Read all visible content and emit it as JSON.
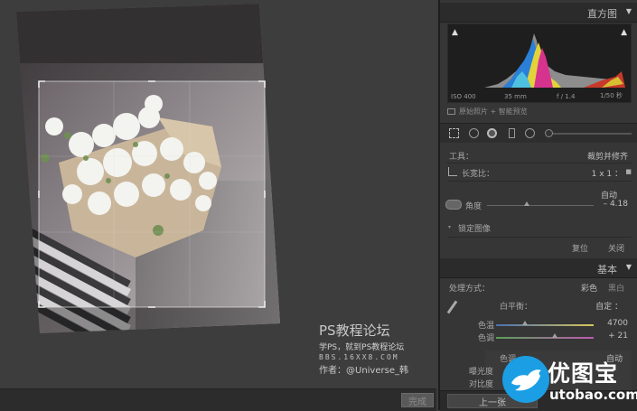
{
  "canvas": {
    "done_label": "完成",
    "watermark": {
      "title": "PS教程论坛",
      "subtitle": "学PS，就到PS教程论坛",
      "site": "BBS.16XX8.COM",
      "author": "作者：@Universe_韩"
    }
  },
  "histogram": {
    "title": "直方图",
    "iso": "ISO 400",
    "focal": "35 mm",
    "aperture": "f / 1.4",
    "shutter": "1/50 秒",
    "preview_label": "原始照片 + 智能预览"
  },
  "crop": {
    "tool_label": "工具：",
    "tool_name": "裁剪并修齐",
    "aspect_label": "长宽比：",
    "aspect_value": "1 x 1 ：",
    "auto_label": "自动",
    "angle_label": "角度",
    "angle_value": "– 4.18",
    "angle_position": 0.37,
    "constrain_label": "锁定图像",
    "reset_label": "复位",
    "close_label": "关闭"
  },
  "basic": {
    "title": "基本",
    "treatment_label": "处理方式：",
    "color_label": "彩色",
    "bw_label": "黑白",
    "wb_label": "白平衡：",
    "wb_value": "自定 ：",
    "temp_label": "色温",
    "temp_value": "4700",
    "temp_position": 0.3,
    "tint_label": "色调",
    "tint_value": "+ 21",
    "tint_position": 0.6,
    "tone_label": "色调",
    "tone_auto": "自动",
    "exposure_label": "曝光度",
    "contrast_label": "对比度"
  },
  "footer": {
    "prev_label": "上一张"
  },
  "logo": {
    "name": "优图宝",
    "url": "utobao.com",
    "icon": "bird-icon"
  },
  "colors": {
    "panel_bg": "#363636",
    "canvas_bg": "#3d3d3d",
    "logo_blue": "#1b9ee4"
  }
}
